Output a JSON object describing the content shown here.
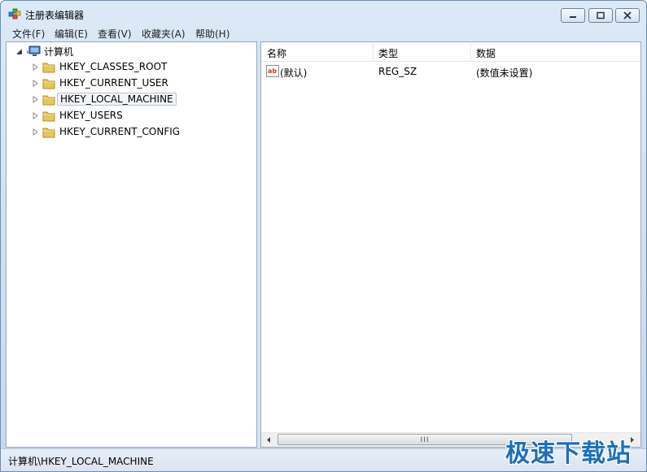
{
  "window": {
    "title": "注册表编辑器"
  },
  "menu": [
    "文件(F)",
    "编辑(E)",
    "查看(V)",
    "收藏夹(A)",
    "帮助(H)"
  ],
  "tree": {
    "root": "计算机",
    "keys": [
      "HKEY_CLASSES_ROOT",
      "HKEY_CURRENT_USER",
      "HKEY_LOCAL_MACHINE",
      "HKEY_USERS",
      "HKEY_CURRENT_CONFIG"
    ],
    "selected": "HKEY_LOCAL_MACHINE"
  },
  "list": {
    "columns": [
      "名称",
      "类型",
      "数据"
    ],
    "rows": [
      {
        "name": "(默认)",
        "type": "REG_SZ",
        "data": "(数值未设置)",
        "icon": "string-value-icon"
      }
    ],
    "scroll_grip": "III"
  },
  "status": {
    "path": "计算机\\HKEY_LOCAL_MACHINE"
  },
  "watermark": "极速下载站",
  "colors": {
    "folder": "#e8c65a",
    "accent": "#1d6fb8"
  }
}
